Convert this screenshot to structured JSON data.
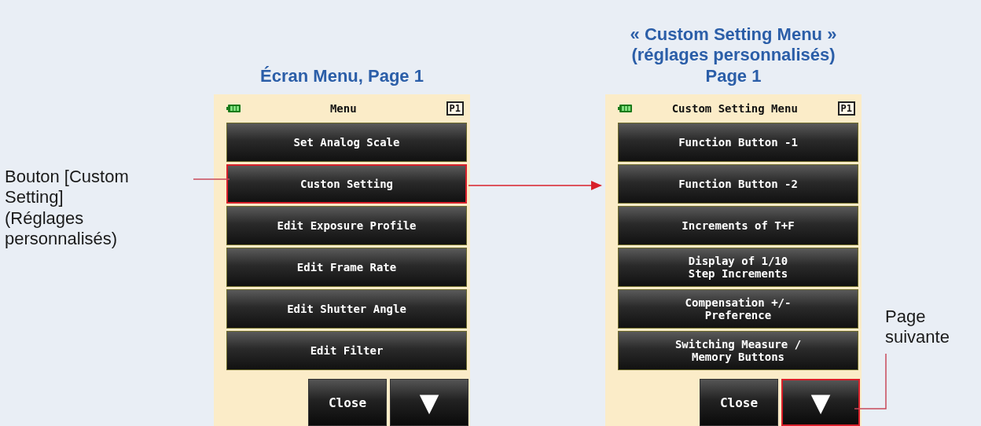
{
  "screens": [
    {
      "caption": [
        "Écran Menu, Page 1"
      ],
      "title": "Menu",
      "page_badge": "P1",
      "items": [
        {
          "label": "Set Analog Scale",
          "highlighted": false
        },
        {
          "label": "Custon Setting",
          "highlighted": true
        },
        {
          "label": "Edit Exposure Profile",
          "highlighted": false
        },
        {
          "label": "Edit Frame Rate",
          "highlighted": false
        },
        {
          "label": "Edit Shutter Angle",
          "highlighted": false
        },
        {
          "label": "Edit Filter",
          "highlighted": false
        }
      ],
      "close_button": "Close",
      "next_button": {
        "label": "▼",
        "highlighted": false
      }
    },
    {
      "caption": [
        "« Custom Setting Menu »",
        "(réglages personnalisés)",
        "Page 1"
      ],
      "title": "Custom Setting Menu",
      "page_badge": "P1",
      "items": [
        {
          "label": "Function Button -1",
          "highlighted": false
        },
        {
          "label": "Function Button -2",
          "highlighted": false
        },
        {
          "label": "Increments of T+F",
          "highlighted": false
        },
        {
          "label": "Display of 1/10\nStep Increments",
          "highlighted": false
        },
        {
          "label": "Compensation +/-\nPreference",
          "highlighted": false
        },
        {
          "label": "Switching Measure /\nMemory Buttons",
          "highlighted": false
        }
      ],
      "close_button": "Close",
      "next_button": {
        "label": "▼",
        "highlighted": true
      }
    }
  ],
  "callouts": [
    {
      "text": "Bouton [Custom\nSetting]\n(Réglages\npersonnalisés)"
    },
    {
      "text": "Page\nsuivante"
    }
  ]
}
